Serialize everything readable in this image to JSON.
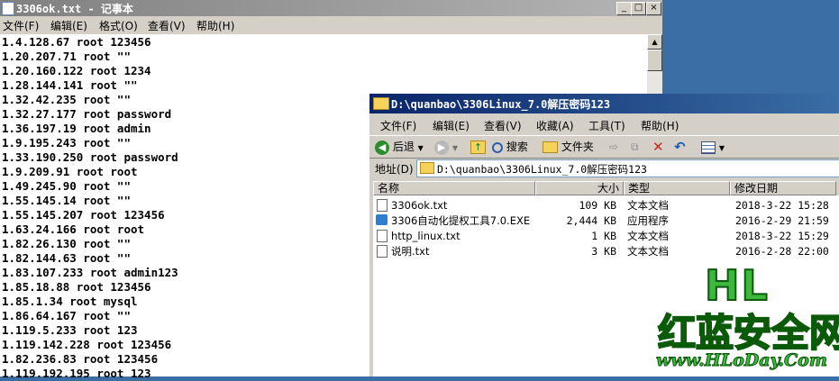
{
  "notepad": {
    "title": "3306ok.txt - 记事本",
    "menu": [
      "文件(F)",
      "编辑(E)",
      "格式(O)",
      "查看(V)",
      "帮助(H)"
    ],
    "controls": {
      "minimize": "_",
      "maximize": "□",
      "close": "×"
    },
    "lines": [
      "1.4.128.67 root 123456",
      "1.20.207.71 root \"\"",
      "1.20.160.122 root 1234",
      "1.28.144.141 root \"\"",
      "1.32.42.235 root \"\"",
      "1.32.27.177 root password",
      "1.36.197.19 root admin",
      "1.9.195.243 root \"\"",
      "1.33.190.250 root password",
      "1.9.209.91 root root",
      "1.49.245.90 root \"\"",
      "1.55.145.14 root \"\"",
      "1.55.145.207 root 123456",
      "1.63.24.166 root root",
      "1.82.26.130 root \"\"",
      "1.82.144.63 root \"\"",
      "1.83.107.233 root admin123",
      "1.85.18.88 root 123456",
      "1.85.1.34 root mysql",
      "1.86.64.167 root \"\"",
      "1.119.5.233 root 123",
      "1.119.142.228 root 123456",
      "1.82.236.83 root 123456",
      "1.119.192.195 root 123"
    ]
  },
  "explorer": {
    "title": "D:\\quanbao\\3306Linux_7.0解压密码123",
    "menu": [
      "文件(F)",
      "编辑(E)",
      "查看(V)",
      "收藏(A)",
      "工具(T)",
      "帮助(H)"
    ],
    "toolbar": {
      "back": "后退",
      "search": "搜索",
      "folders": "文件夹"
    },
    "address_label": "地址(D)",
    "address": "D:\\quanbao\\3306Linux_7.0解压密码123",
    "columns": [
      "名称",
      "大小",
      "类型",
      "修改日期"
    ],
    "files": [
      {
        "name": "3306ok.txt",
        "size": "109 KB",
        "type": "文本文档",
        "date": "2018-3-22 15:28",
        "icon": "text-file-icon"
      },
      {
        "name": "3306自动化提权工具7.0.EXE",
        "size": "2,444 KB",
        "type": "应用程序",
        "date": "2016-2-29 21:59",
        "icon": "exe-icon"
      },
      {
        "name": "http_linux.txt",
        "size": "1 KB",
        "type": "文本文档",
        "date": "2018-3-22 15:29",
        "icon": "text-file-icon"
      },
      {
        "name": "说明.txt",
        "size": "3 KB",
        "type": "文本文档",
        "date": "2016-2-28 22:00",
        "icon": "text-file-icon"
      }
    ]
  },
  "watermark": {
    "line1": "HL",
    "line2": "红蓝安全网",
    "line3": "www.HLoDay.Com"
  }
}
